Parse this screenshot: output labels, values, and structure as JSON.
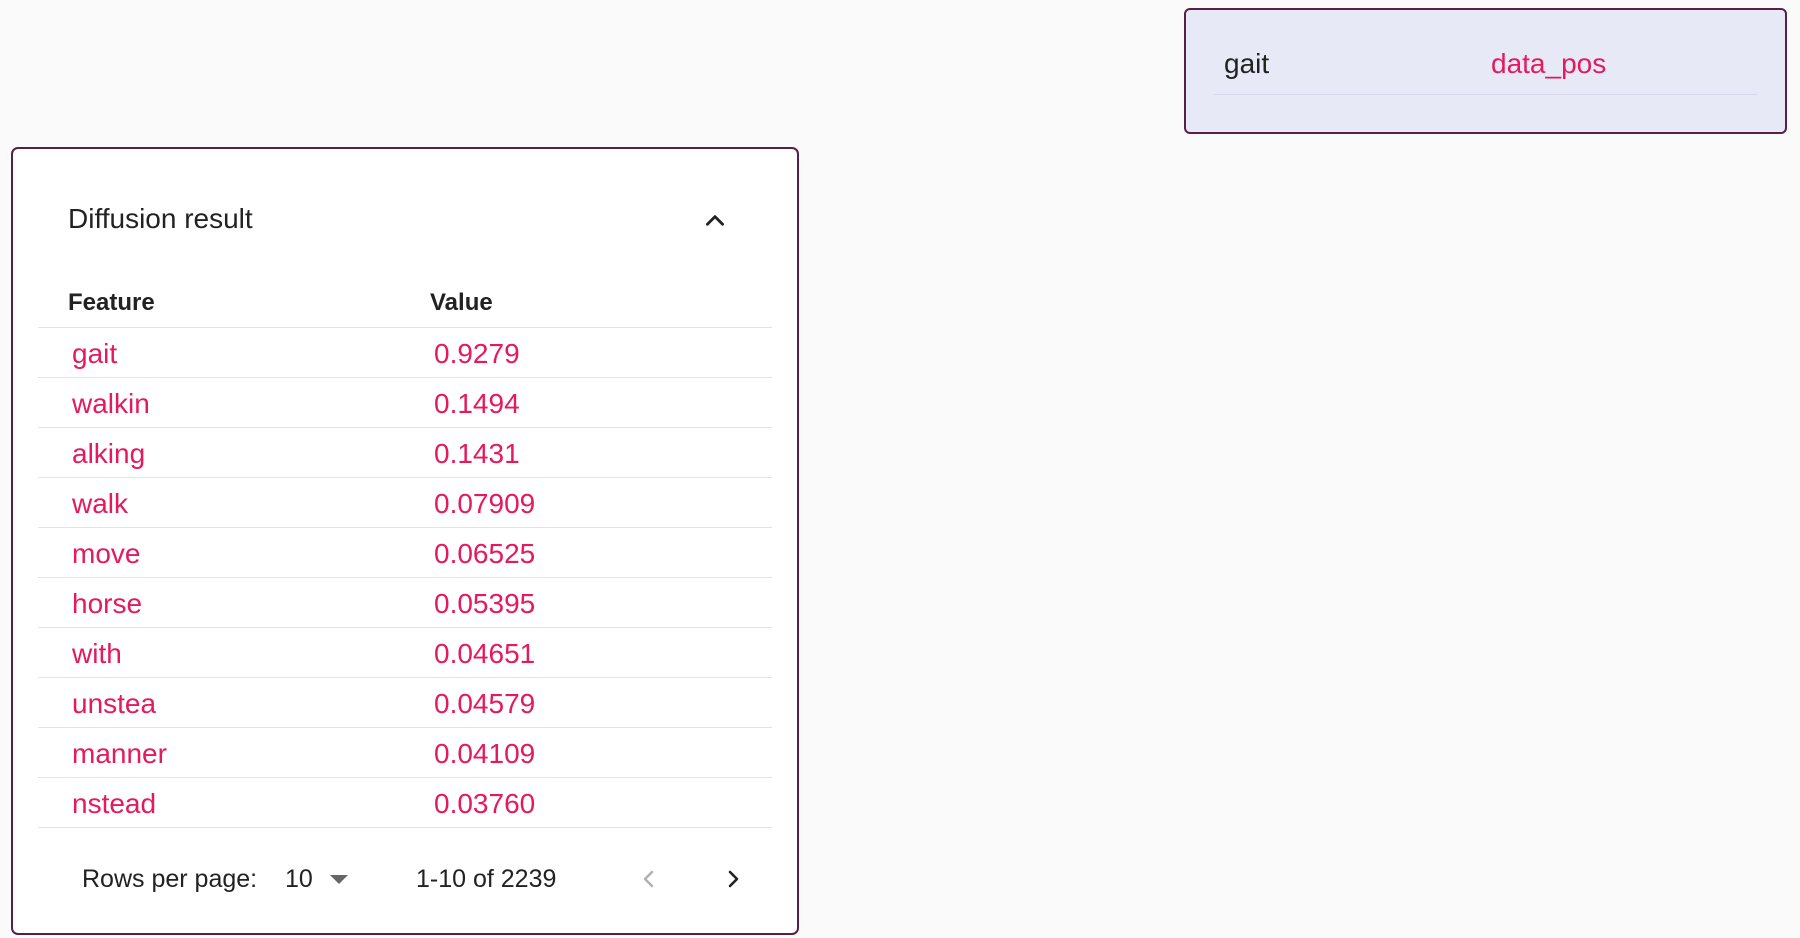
{
  "info_card": {
    "key": "gait",
    "value": "data_pos"
  },
  "result_card": {
    "title": "Diffusion result",
    "collapse_icon": "chevron-up-icon",
    "columns": {
      "feature": "Feature",
      "value": "Value"
    },
    "rows": [
      {
        "feature": "gait",
        "value": "0.9279"
      },
      {
        "feature": "walkin",
        "value": "0.1494"
      },
      {
        "feature": "alking",
        "value": "0.1431"
      },
      {
        "feature": "walk",
        "value": "0.07909"
      },
      {
        "feature": "move",
        "value": "0.06525"
      },
      {
        "feature": "horse",
        "value": "0.05395"
      },
      {
        "feature": "with",
        "value": "0.04651"
      },
      {
        "feature": "unstea",
        "value": "0.04579"
      },
      {
        "feature": "manner",
        "value": "0.04109"
      },
      {
        "feature": "nstead",
        "value": "0.03760"
      }
    ],
    "paginator": {
      "rows_per_page_label": "Rows per page:",
      "rows_per_page": "10",
      "range": "1-10 of 2239",
      "prev_icon": "chevron-left-icon",
      "next_icon": "chevron-right-icon"
    }
  },
  "colors": {
    "accent_pink": "#e5195e",
    "border_plum": "#5a1f45",
    "info_bg": "#e7e9f6"
  }
}
